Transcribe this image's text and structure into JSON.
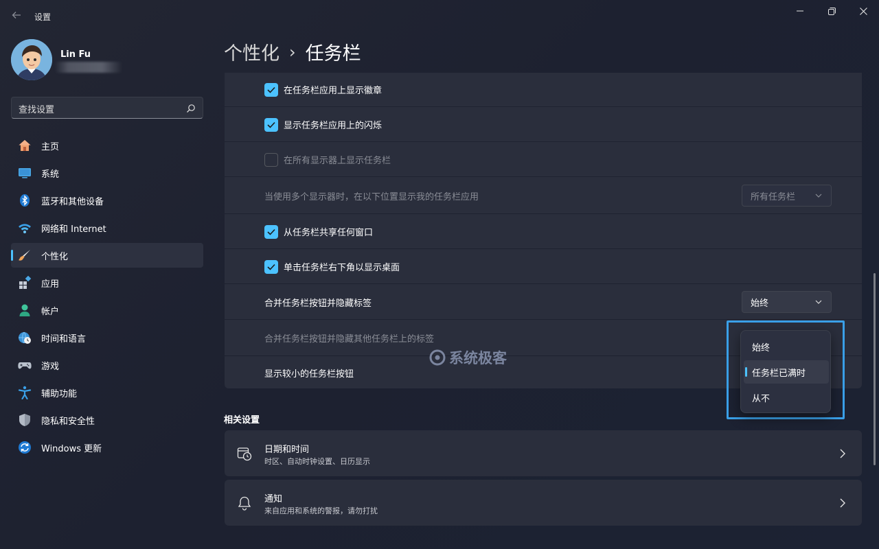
{
  "window": {
    "title": "设置",
    "back_icon": "back-arrow-icon",
    "controls": [
      "minimize-icon",
      "maximize-icon",
      "close-icon"
    ]
  },
  "profile": {
    "name": "Lin Fu"
  },
  "search": {
    "placeholder": "查找设置",
    "icon": "search-icon"
  },
  "sidebar": {
    "items": [
      {
        "label": "主页",
        "icon": "home-icon",
        "active": false
      },
      {
        "label": "系统",
        "icon": "system-icon",
        "active": false
      },
      {
        "label": "蓝牙和其他设备",
        "icon": "bluetooth-icon",
        "active": false
      },
      {
        "label": "网络和 Internet",
        "icon": "wifi-icon",
        "active": false
      },
      {
        "label": "个性化",
        "icon": "paintbrush-icon",
        "active": true
      },
      {
        "label": "应用",
        "icon": "apps-icon",
        "active": false
      },
      {
        "label": "帐户",
        "icon": "account-icon",
        "active": false
      },
      {
        "label": "时间和语言",
        "icon": "globe-clock-icon",
        "active": false
      },
      {
        "label": "游戏",
        "icon": "gamepad-icon",
        "active": false
      },
      {
        "label": "辅助功能",
        "icon": "accessibility-icon",
        "active": false
      },
      {
        "label": "隐私和安全性",
        "icon": "shield-icon",
        "active": false
      },
      {
        "label": "Windows 更新",
        "icon": "update-icon",
        "active": false
      }
    ]
  },
  "breadcrumb": {
    "parent": "个性化",
    "separator": "›",
    "current": "任务栏"
  },
  "taskbar_settings": {
    "rows": [
      {
        "label": "在任务栏应用上显示徽章",
        "checked": true
      },
      {
        "label": "显示任务栏应用上的闪烁",
        "checked": true
      },
      {
        "label": "在所有显示器上显示任务栏",
        "checked": false
      },
      {
        "label": "当使用多个显示器时，在以下位置显示我的任务栏应用",
        "combo": "所有任务栏"
      },
      {
        "label": "从任务栏共享任何窗口",
        "checked": true
      },
      {
        "label": "单击任务栏右下角以显示桌面",
        "checked": true
      },
      {
        "label": "合并任务栏按钮并隐藏标签",
        "combo": "始终"
      },
      {
        "label": "合并任务栏按钮并隐藏其他任务栏上的标签"
      },
      {
        "label": "显示较小的任务栏按钮"
      }
    ]
  },
  "dropdown": {
    "options": [
      "始终",
      "任务栏已满时",
      "从不"
    ],
    "selected_index": 1
  },
  "watermark": {
    "text": "系统极客"
  },
  "related": {
    "title": "相关设置",
    "items": [
      {
        "title": "日期和时间",
        "subtitle": "时区、自动时钟设置、日历显示",
        "icon": "calendar-clock-icon"
      },
      {
        "title": "通知",
        "subtitle": "来自应用和系统的警报，请勿打扰",
        "icon": "bell-icon"
      }
    ]
  },
  "colors": {
    "accent": "#4cc2ff",
    "highlight_border": "#3aa0e8",
    "background": "#1f2433",
    "card": "#2a2e3c"
  }
}
